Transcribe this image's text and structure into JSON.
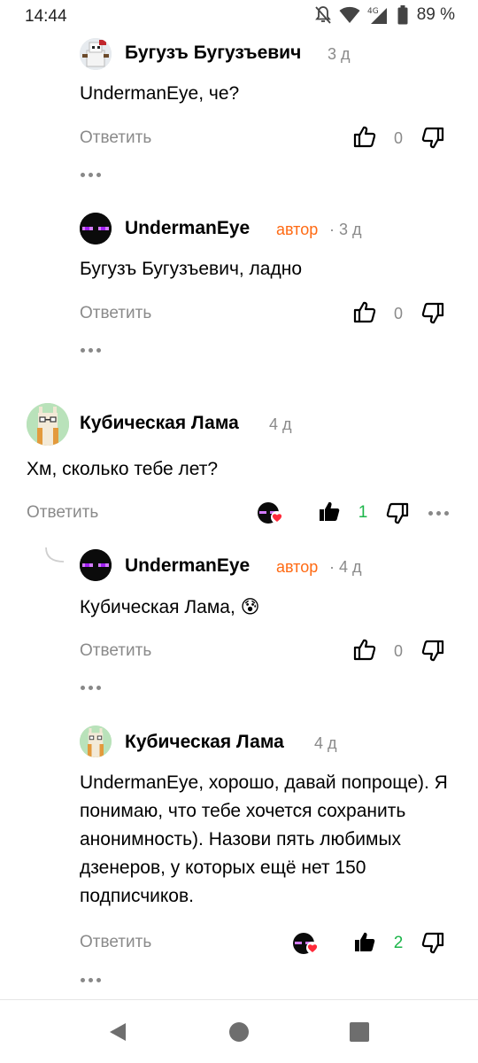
{
  "status_bar": {
    "time": "14:44",
    "network": "4G",
    "battery_percent": "89 %"
  },
  "comments": [
    {
      "author": "Бугузъ Бугузъевич",
      "time": "3 д",
      "text": "UndermanEye, че?",
      "reply_label": "Ответить",
      "likes": "0"
    },
    {
      "author": "UndermanEye",
      "badge": "автор",
      "time": "· 3 д",
      "text": "Бугузъ Бугузъевич, ладно",
      "reply_label": "Ответить",
      "likes": "0"
    },
    {
      "author": "Кубическая Лама",
      "time": "4 д",
      "text": "Хм, сколько тебе лет?",
      "reply_label": "Ответить",
      "likes": "1"
    },
    {
      "author": "UndermanEye",
      "badge": "автор",
      "time": "· 4 д",
      "text": "Кубическая Лама, 😰",
      "reply_label": "Ответить",
      "likes": "0"
    },
    {
      "author": "Кубическая Лама",
      "time": "4 д",
      "text": "UndermanEye, хорошо, давай попроще). Я понимаю, что тебе хочется сохранить анонимность). Назови пять любимых дзенеров, у которых ещё нет 150 подписчиков.",
      "reply_label": "Ответить",
      "likes": "2"
    }
  ],
  "colors": {
    "author_badge": "#ff6a13",
    "like_active": "#1cb54a",
    "muted": "#8a8a8a"
  }
}
